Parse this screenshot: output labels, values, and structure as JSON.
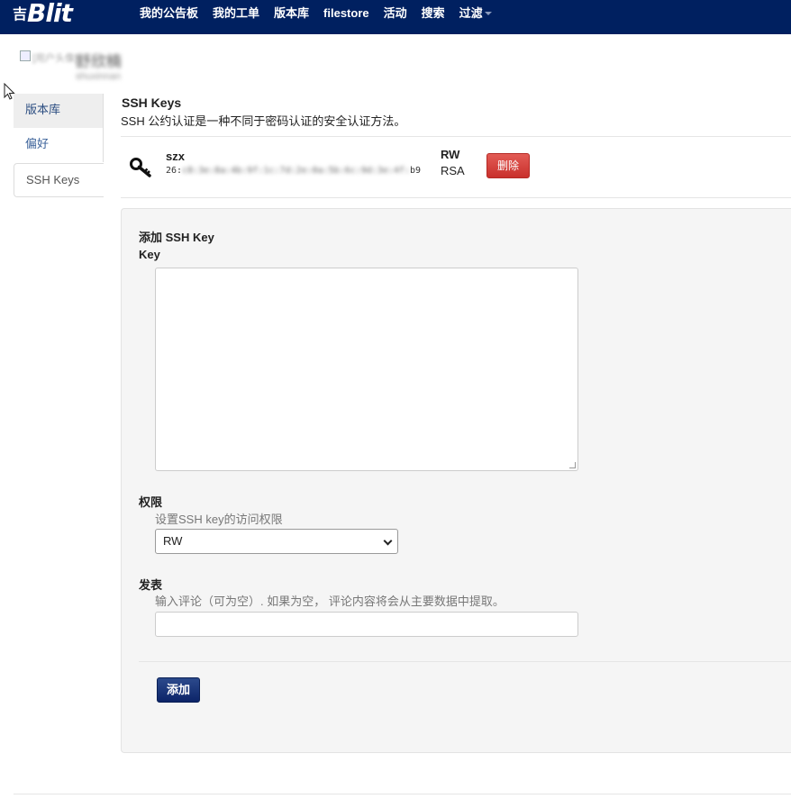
{
  "app": {
    "brand": "Blit",
    "brand_prefix": "吉"
  },
  "navbar": {
    "items": [
      "我的公告板",
      "我的工单",
      "版本库",
      "filestore",
      "活动",
      "搜索",
      "过滤"
    ]
  },
  "user": {
    "avatar_alt": "[用户头像]",
    "name": "舒欣楠",
    "username": "shuxinnan"
  },
  "sidebar": {
    "items": [
      {
        "label": "版本库"
      },
      {
        "label": "偏好"
      },
      {
        "label": "SSH Keys"
      }
    ]
  },
  "ssh": {
    "title": "SSH Keys",
    "description": "SSH 公约认证是一种不同于密码认证的安全认证方法。",
    "keys": [
      {
        "name": "szx",
        "fp_start": "26:",
        "fp_masked": "c8:3e:8a:4b:9f:1c:7d:2e:0a:5b:6c:9d:3e:4f:",
        "fp_end": "b9",
        "permission": "RW",
        "type": "RSA",
        "delete_label": "删除"
      }
    ]
  },
  "add_form": {
    "title": "添加 SSH Key",
    "key_label": "Key",
    "key_value": "",
    "perm_label": "权限",
    "perm_help": "设置SSH key的访问权限",
    "perm_value": "RW",
    "comment_label": "发表",
    "comment_help": "输入评论（可为空）. 如果为空， 评论内容将会从主要数据中提取。",
    "comment_value": "",
    "submit_label": "添加"
  },
  "icons": {
    "key": "key-icon",
    "cursor": "cursor-icon",
    "caret": "caret-icon",
    "chevron": "chevron-down-icon"
  },
  "colors": {
    "navbar": "#002060",
    "delete_button": "#d9534f",
    "add_button": "#1a3677",
    "link": "#3a6199"
  }
}
